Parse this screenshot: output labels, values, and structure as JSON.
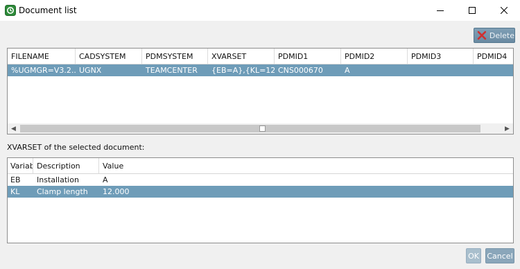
{
  "window": {
    "title": "Document list",
    "minimize_label": "minimize",
    "maximize_label": "maximize",
    "close_label": "close"
  },
  "toolbar": {
    "delete_label": "Delete"
  },
  "documents": {
    "columns": [
      "FILENAME",
      "CADSYSTEM",
      "PDMSYSTEM",
      "XVARSET",
      "PDMID1",
      "PDMID2",
      "PDMID3",
      "PDMID4"
    ],
    "rows": [
      [
        "%UGMGR=V3.2...",
        "UGNX",
        "TEAMCENTER",
        "{EB=A},{KL=12....",
        "CNS000670",
        "A",
        "",
        ""
      ]
    ],
    "selected_row": 0
  },
  "xvarset_label": "XVARSET of the selected document:",
  "xvarset": {
    "columns": [
      "Variab",
      "Description",
      "Value"
    ],
    "rows": [
      [
        "EB",
        "Installation",
        "A"
      ],
      [
        "KL",
        "Clamp length",
        "12.000"
      ]
    ],
    "selected_row": 1
  },
  "footer": {
    "ok_label": "OK",
    "cancel_label": "Cancel"
  },
  "colors": {
    "selection": "#6e9cb8",
    "button": "#6a8aa2",
    "delete_icon": "#d03030",
    "app_icon": "#2e8b3a"
  }
}
